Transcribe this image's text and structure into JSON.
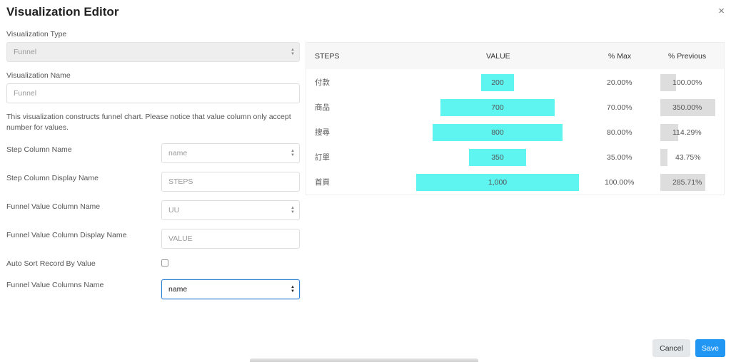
{
  "dialog": {
    "title": "Visualization Editor",
    "close_glyph": "×"
  },
  "form": {
    "viz_type_label": "Visualization Type",
    "viz_type_value": "Funnel",
    "viz_name_label": "Visualization Name",
    "viz_name_value": "Funnel",
    "help_text": "This visualization constructs funnel chart. Please notice that value column only accept number for values.",
    "step_col_label": "Step Column Name",
    "step_col_value": "name",
    "step_display_label": "Step Column Display Name",
    "step_display_placeholder": "STEPS",
    "value_col_label": "Funnel Value Column Name",
    "value_col_value": "UU",
    "value_display_label": "Funnel Value Column Display Name",
    "value_display_placeholder": "VALUE",
    "auto_sort_label": "Auto Sort Record By Value",
    "auto_sort_checked": false,
    "value_cols_label": "Funnel Value Columns Name",
    "value_cols_value": "name"
  },
  "preview": {
    "headers": {
      "steps": "STEPS",
      "value": "VALUE",
      "pct_max": "% Max",
      "pct_prev": "% Previous"
    },
    "rows": [
      {
        "step": "付款",
        "value": "200",
        "pct_max": "20.00%",
        "pct_prev": "100.00%"
      },
      {
        "step": "商品",
        "value": "700",
        "pct_max": "70.00%",
        "pct_prev": "350.00%"
      },
      {
        "step": "搜尋",
        "value": "800",
        "pct_max": "80.00%",
        "pct_prev": "114.29%"
      },
      {
        "step": "訂單",
        "value": "350",
        "pct_max": "35.00%",
        "pct_prev": "43.75%"
      },
      {
        "step": "首頁",
        "value": "1,000",
        "pct_max": "100.00%",
        "pct_prev": "285.71%"
      }
    ],
    "colors": {
      "value_bar": "#5ef4f0",
      "prev_bar": "#dddddd"
    }
  },
  "footer": {
    "cancel_label": "Cancel",
    "save_label": "Save"
  }
}
